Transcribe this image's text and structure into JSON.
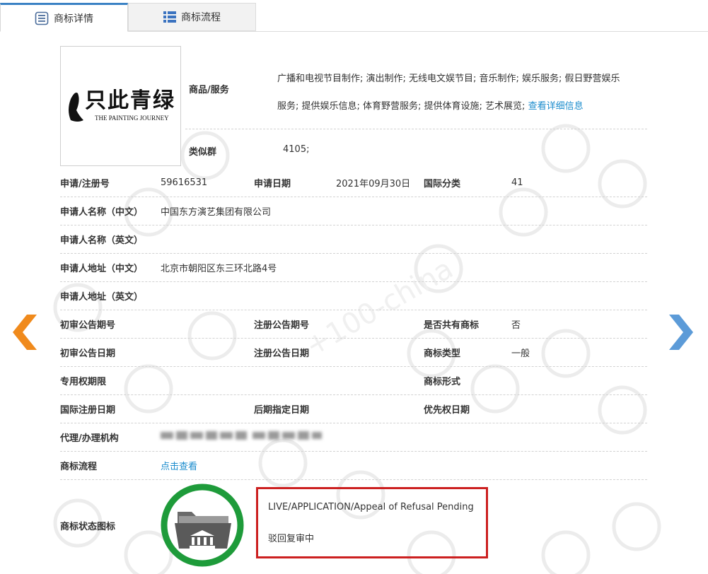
{
  "tabs": [
    {
      "label": "商标详情",
      "icon": "document-list-icon",
      "active": true
    },
    {
      "label": "商标流程",
      "icon": "grid-list-icon",
      "active": false
    }
  ],
  "colors": {
    "accent": "#3b82c4",
    "link": "#1b8ccd",
    "left_arrow": "#f08a1c",
    "right_arrow": "#5c9bd8",
    "status_ring": "#1e9b3a",
    "highlight": "#cc2020"
  },
  "trademark": {
    "logo_icon": "trademark-logo-image",
    "goods_services_label": "商品/服务",
    "goods_services_line1": "广播和电视节目制作; 演出制作; 无线电文娱节目; 音乐制作; 娱乐服务; 假日野营娱乐",
    "goods_services_line2": "服务; 提供娱乐信息; 体育野营服务; 提供体育设施; 艺术展览;",
    "view_detail_link": "查看详细信息",
    "similar_group_label": "类似群",
    "similar_group_value": "4105;"
  },
  "fields": {
    "reg_no_label": "申请/注册号",
    "reg_no": "59616531",
    "app_date_label": "申请日期",
    "app_date": "2021年09月30日",
    "intl_class_label": "国际分类",
    "intl_class": "41",
    "applicant_cn_label": "申请人名称（中文）",
    "applicant_cn": "中国东方演艺集团有限公司",
    "applicant_en_label": "申请人名称（英文）",
    "applicant_en": "",
    "address_cn_label": "申请人地址（中文）",
    "address_cn": "北京市朝阳区东三环北路4号",
    "address_en_label": "申请人地址（英文）",
    "address_en": "",
    "prelim_pub_no_label": "初审公告期号",
    "prelim_pub_no": "",
    "reg_pub_no_label": "注册公告期号",
    "reg_pub_no": "",
    "shared_label": "是否共有商标",
    "shared": "否",
    "prelim_pub_date_label": "初审公告日期",
    "prelim_pub_date": "",
    "reg_pub_date_label": "注册公告日期",
    "reg_pub_date": "",
    "tm_type_label": "商标类型",
    "tm_type": "一般",
    "exclusive_period_label": "专用权期限",
    "exclusive_period": "",
    "tm_form_label": "商标形式",
    "tm_form": "",
    "intl_reg_date_label": "国际注册日期",
    "intl_reg_date": "",
    "later_designation_label": "后期指定日期",
    "later_designation": "",
    "priority_date_label": "优先权日期",
    "priority_date": "",
    "agent_label": "代理/办理机构",
    "flow_label": "商标流程",
    "flow_link": "点击查看",
    "status_icon_label": "商标状态图标"
  },
  "status": {
    "icon": "folder-court-status-icon",
    "en": "LIVE/APPLICATION/Appeal of Refusal Pending",
    "cn": "驳回复审中"
  },
  "nav": {
    "prev_icon": "chevron-left-icon",
    "next_icon": "chevron-right-icon"
  }
}
